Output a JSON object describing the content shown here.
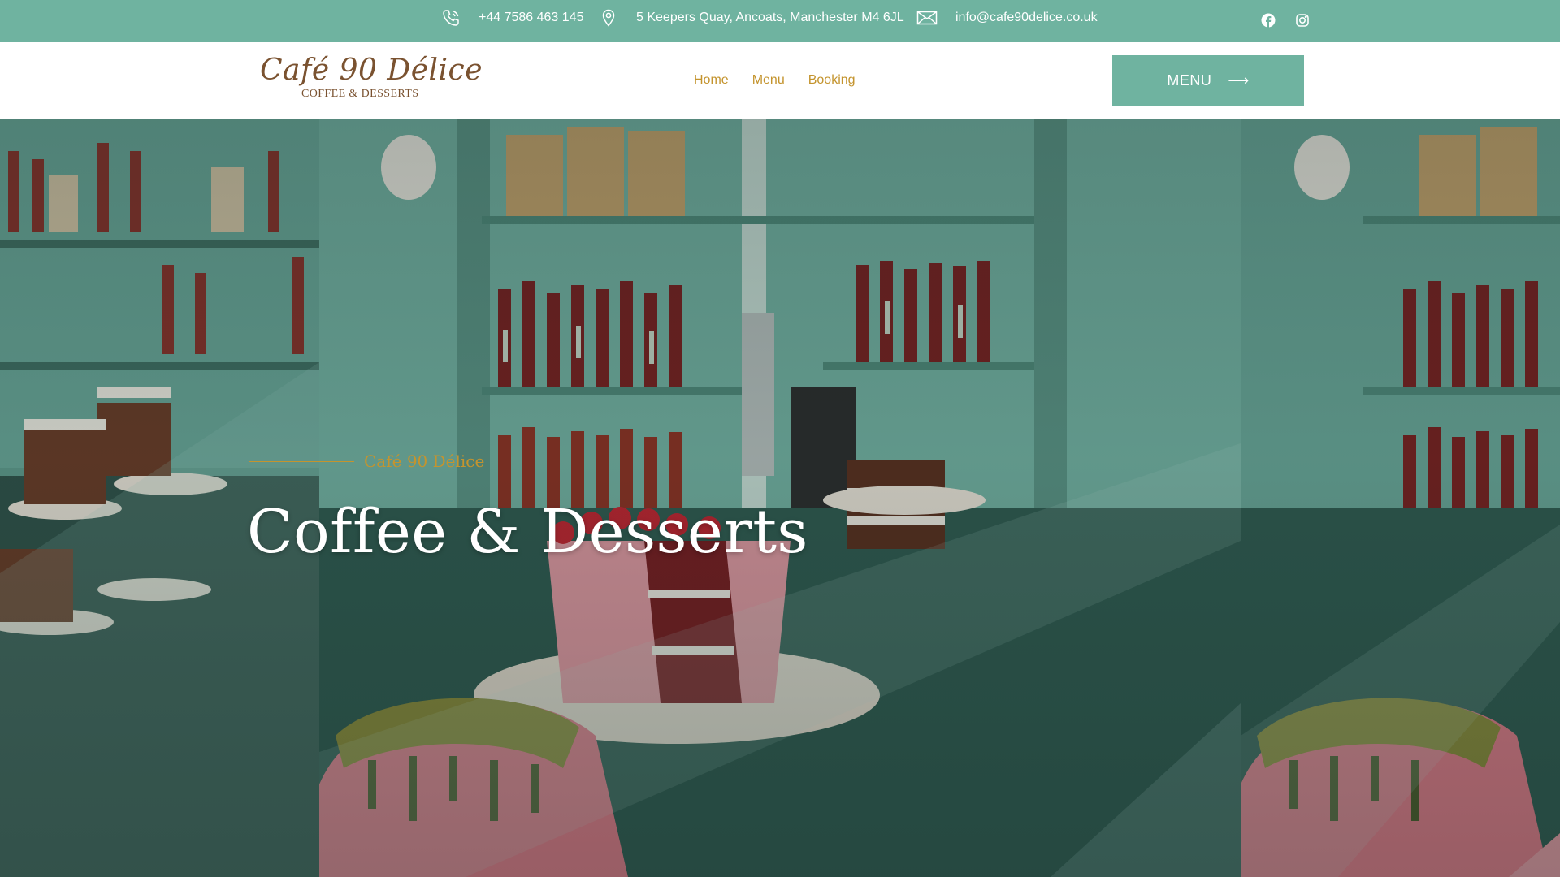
{
  "contact_bar": {
    "phone": "+44 7586 463 145",
    "address": "5 Keepers Quay, Ancoats, Manchester M4 6JL",
    "email": "info@cafe90delice.co.uk",
    "icons": [
      "phone-icon",
      "location-pin-icon",
      "envelope-icon",
      "facebook-icon",
      "instagram-icon"
    ]
  },
  "header": {
    "logo": {
      "name": "Café 90 Délice",
      "tagline": "COFFEE & DESSERTS"
    },
    "nav": [
      {
        "label": "Home"
      },
      {
        "label": "Menu"
      },
      {
        "label": "Booking"
      }
    ],
    "menu_button": {
      "label": "MENU",
      "arrow": "⟶"
    }
  },
  "hero": {
    "kicker": "Café 90 Délice",
    "title": "Coffee & Desserts",
    "image_subject": "cake display counter with pink layered cakes, pistachio drip cake and syrup bottles on teal shelves"
  },
  "colors": {
    "accent_teal": "#6fb3a0",
    "gold": "#c4942e",
    "logo_brown": "#7a5230",
    "white": "#ffffff"
  }
}
